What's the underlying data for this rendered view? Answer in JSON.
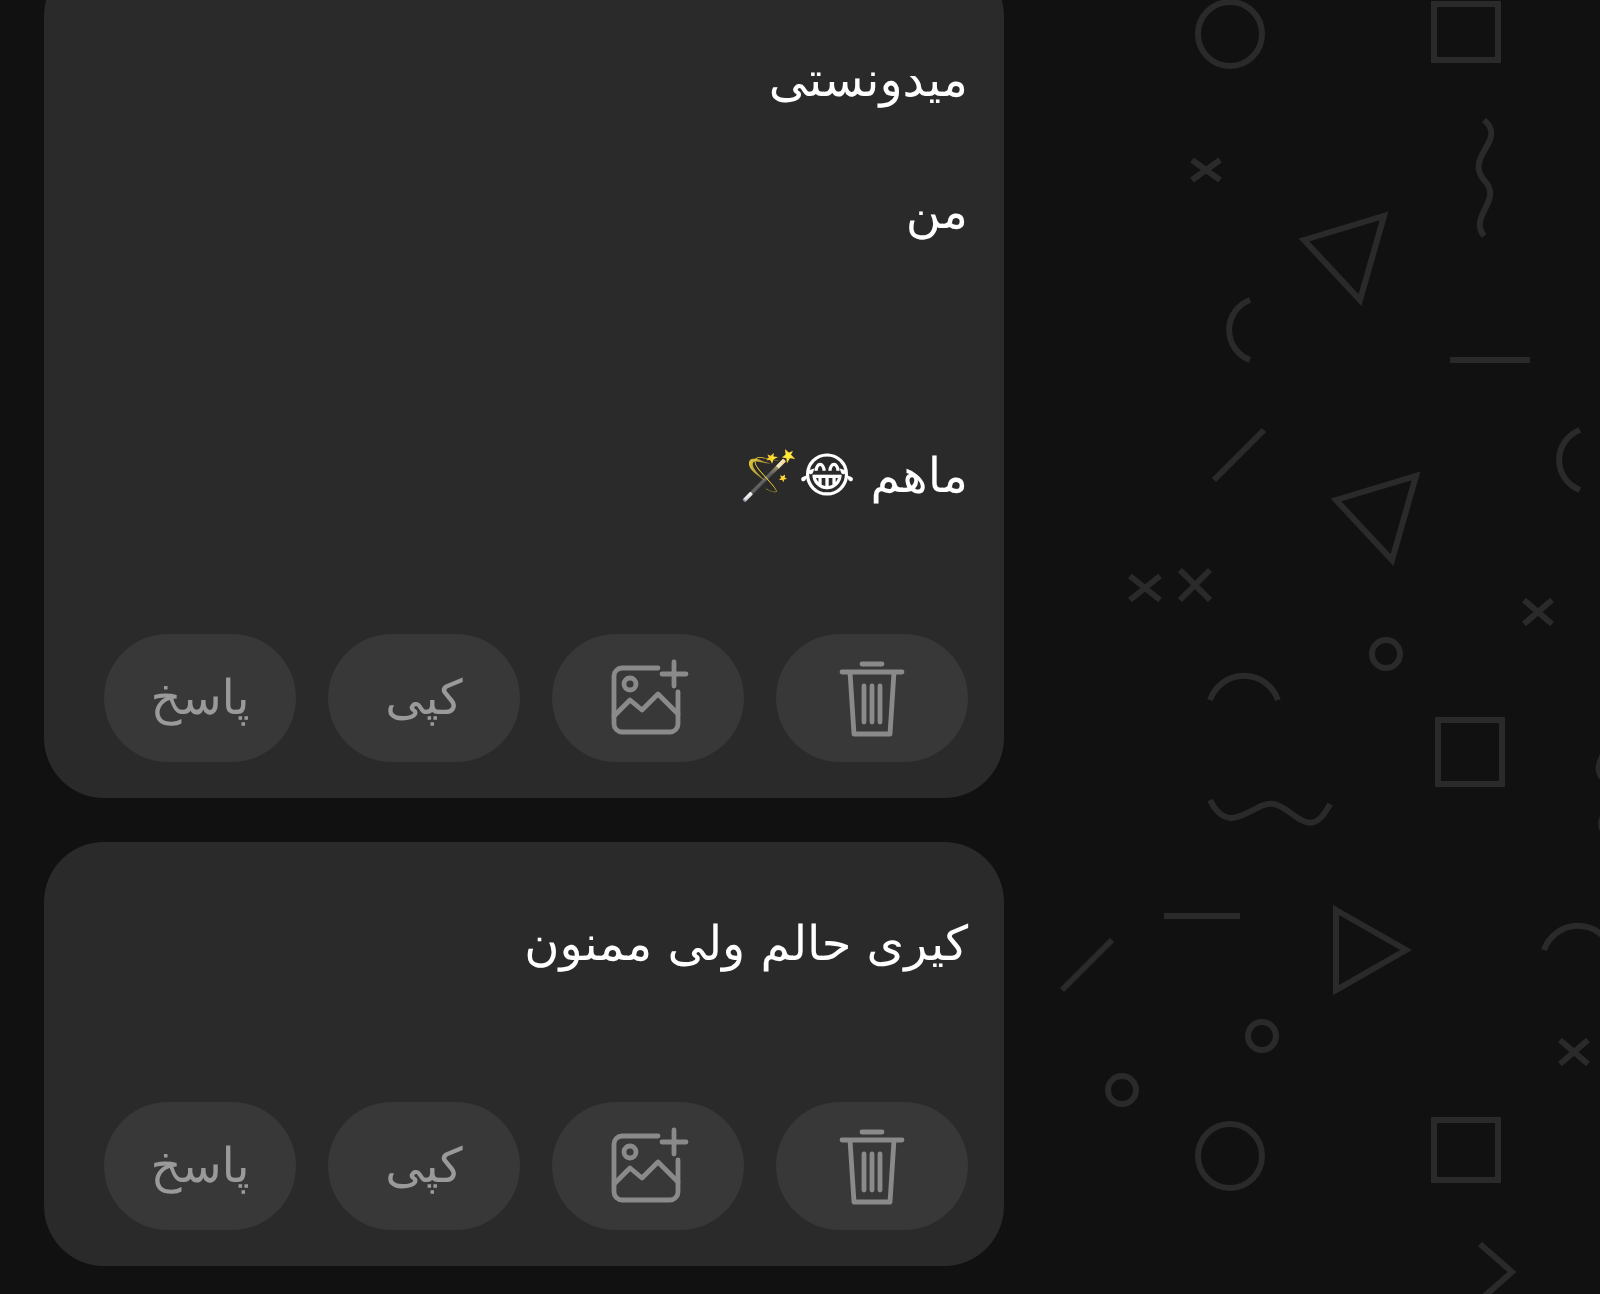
{
  "messages": [
    {
      "text": "میدونستی\nمن\n\nماهم 😂🪄",
      "actions": [
        {
          "kind": "delete"
        },
        {
          "kind": "add_image"
        },
        {
          "kind": "copy",
          "label": "کپی"
        },
        {
          "kind": "reply",
          "label": "پاسخ"
        }
      ]
    },
    {
      "text": "کیری حالم ولی ممنون",
      "actions": [
        {
          "kind": "delete"
        },
        {
          "kind": "add_image"
        },
        {
          "kind": "copy",
          "label": "کپی"
        },
        {
          "kind": "reply",
          "label": "پاسخ"
        }
      ]
    }
  ]
}
